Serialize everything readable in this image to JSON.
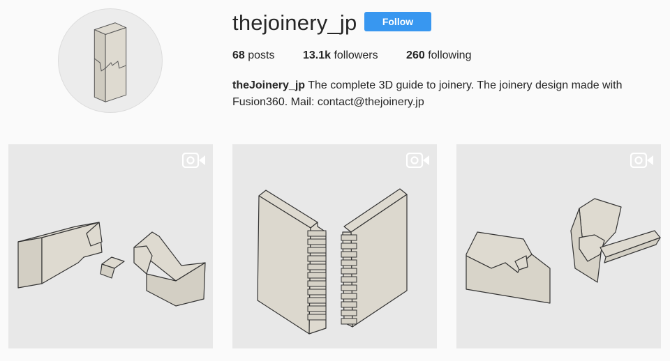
{
  "profile": {
    "username": "thejoinery_jp",
    "follow_label": "Follow",
    "stats": {
      "posts_count": "68",
      "posts_label": "posts",
      "followers_count": "13.1k",
      "followers_label": "followers",
      "following_count": "260",
      "following_label": "following"
    },
    "bio": {
      "display_name": "theJoinery_jp",
      "text_line1": " The complete 3D guide to joinery. The joinery design made with",
      "text_line2": "Fusion360. Mail: contact@thejoinery.jp"
    }
  },
  "posts": [
    {
      "type": "video",
      "icon": "video-camera-icon",
      "subject": "sliding dovetail beam joint with key"
    },
    {
      "type": "video",
      "icon": "video-camera-icon",
      "subject": "finger joint boards"
    },
    {
      "type": "video",
      "icon": "video-camera-icon",
      "subject": "angled dovetail joint"
    }
  ],
  "colors": {
    "follow_button": "#3897f0",
    "background": "#fafafa",
    "wood": "#dedad0",
    "outline": "#3a3a3a"
  }
}
